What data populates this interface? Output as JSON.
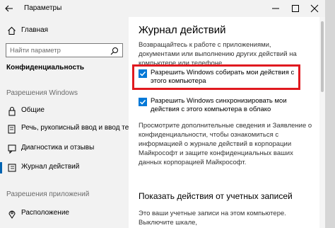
{
  "window": {
    "title": "Параметры",
    "back_icon": "arrow-left-icon",
    "minimize_icon": "minimize-icon",
    "maximize_icon": "maximize-icon",
    "close_icon": "close-icon"
  },
  "sidebar": {
    "home_label": "Главная",
    "search_placeholder": "Найти параметр",
    "section_title": "Конфиденциальность",
    "group_windows": "Разрешения Windows",
    "group_apps": "Разрешения приложений",
    "items": [
      {
        "label": "Общие",
        "icon": "lock-icon"
      },
      {
        "label": "Речь, рукописный ввод и ввод текста",
        "icon": "pen-icon"
      },
      {
        "label": "Диагностика и отзывы",
        "icon": "feedback-icon"
      },
      {
        "label": "Журнал действий",
        "icon": "history-icon"
      }
    ],
    "app_items": [
      {
        "label": "Расположение",
        "icon": "location-icon"
      }
    ]
  },
  "main": {
    "title": "Журнал действий",
    "description": "Возвращайтесь к работе с приложениями, документами или выполнению других действий на компьютере или телефоне.",
    "checkboxes": [
      {
        "label": "Разрешить Windows собирать мои действия с этого компьютера",
        "checked": true
      },
      {
        "label": "Разрешить Windows синхронизировать мои действия с этого компьютера в облако",
        "checked": true
      }
    ],
    "privacy_text": "Просмотрите дополнительные сведения и Заявление о конфиденциальности, чтобы ознакомиться с информацией о журнале действий в корпорации Майкрософт и защите конфиденциальных ваших данных корпорацией Майкрософт.",
    "section_title": "Показать действия от учетных записей",
    "section_text": "Это ваши учетные записи на этом компьютере. Выключите шкале,"
  },
  "colors": {
    "accent": "#0078d7",
    "highlight": "#e0191f",
    "sidebar_bg": "#f2f2f2"
  }
}
